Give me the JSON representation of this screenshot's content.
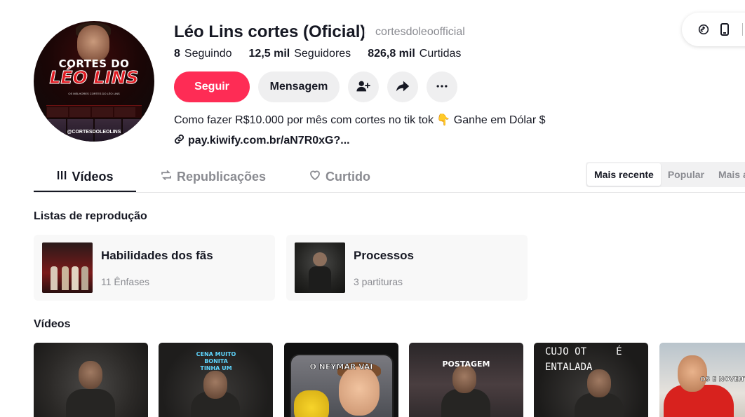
{
  "profile": {
    "display_name": "Léo Lins cortes (Oficial)",
    "username": "cortesdoleoofficial",
    "avatar_text": {
      "line1": "CORTES DO",
      "line2": "LÉO LINS",
      "line3": "OS MELHORES CORTES DO LÉO LINS",
      "handle": "@CORTESDOLEOLINS"
    },
    "bio": "Como fazer R$10.000 por mês com cortes no tik tok 👇 Ganhe em Dólar $",
    "link": "pay.kiwify.com.br/aN7R0xG?..."
  },
  "stats": [
    {
      "value": "8",
      "label": "Seguindo"
    },
    {
      "value": "12,5 mil",
      "label": "Seguidores"
    },
    {
      "value": "826,8 mil",
      "label": "Curtidas"
    }
  ],
  "actions": {
    "follow": "Seguir",
    "message": "Mensagem"
  },
  "tabs": [
    {
      "label": "Vídeos",
      "icon": "grid-icon",
      "active": true
    },
    {
      "label": "Republicações",
      "icon": "repost-icon",
      "active": false
    },
    {
      "label": "Curtido",
      "icon": "heart-icon",
      "active": false
    }
  ],
  "sort": [
    {
      "label": "Mais recente",
      "active": true
    },
    {
      "label": "Popular",
      "active": false
    },
    {
      "label": "Mais antigo",
      "active": false
    }
  ],
  "playlists_section": {
    "title": "Listas de reprodução",
    "items": [
      {
        "name": "Habilidades dos fãs",
        "count": "11 Ênfases"
      },
      {
        "name": "Processos",
        "count": "3 partituras"
      }
    ]
  },
  "videos_section": {
    "title": "Vídeos",
    "captions": [
      "",
      "CENA MUITO BONITA TINHA UM",
      "O NEYMAR VAI",
      "POSTAGEM",
      "CUJO OT     É ENTALADA",
      "OS E NOVENT"
    ]
  },
  "colors": {
    "accent": "#fe2c55",
    "text": "#161823",
    "muted": "#8a8b91"
  }
}
